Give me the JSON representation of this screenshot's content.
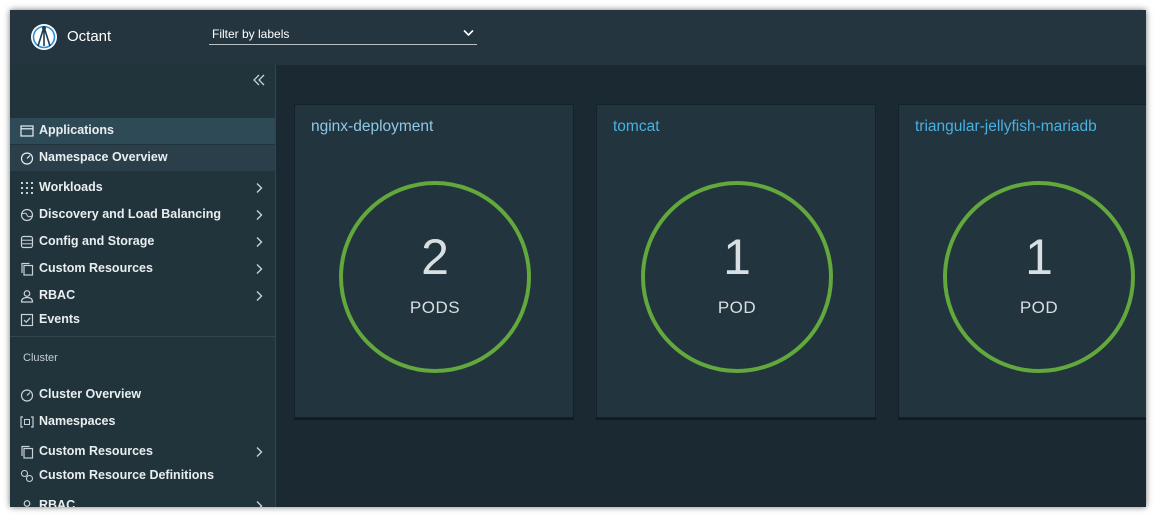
{
  "header": {
    "app_name": "Octant",
    "filter_placeholder": "Filter by labels"
  },
  "sidebar": {
    "items": [
      {
        "label": "Applications",
        "icon": "application-icon",
        "has_children": false,
        "state": "active"
      },
      {
        "label": "Namespace Overview",
        "icon": "dashboard-icon",
        "has_children": false,
        "state": "selected"
      },
      {
        "label": "Workloads",
        "icon": "grid-icon",
        "has_children": true
      },
      {
        "label": "Discovery and Load Balancing",
        "icon": "network-globe-icon",
        "has_children": true
      },
      {
        "label": "Config and Storage",
        "icon": "storage-icon",
        "has_children": true
      },
      {
        "label": "Custom Resources",
        "icon": "copy-icon",
        "has_children": true
      },
      {
        "label": "RBAC",
        "icon": "user-icon",
        "has_children": true
      },
      {
        "label": "Events",
        "icon": "checkbox-icon",
        "has_children": false
      }
    ],
    "cluster_section": {
      "label": "Cluster",
      "items": [
        {
          "label": "Cluster Overview",
          "icon": "dashboard-icon",
          "has_children": false
        },
        {
          "label": "Namespaces",
          "icon": "namespace-icon",
          "has_children": false
        },
        {
          "label": "Custom Resources",
          "icon": "copy-icon",
          "has_children": true
        },
        {
          "label": "Custom Resource Definitions",
          "icon": "crd-icon",
          "has_children": false
        },
        {
          "label": "RBAC",
          "icon": "user-icon",
          "has_children": true
        }
      ]
    }
  },
  "apps": [
    {
      "name": "nginx-deployment",
      "count": "2",
      "unit": "PODS"
    },
    {
      "name": "tomcat",
      "count": "1",
      "unit": "POD"
    },
    {
      "name": "triangular-jellyfish-mariadb",
      "count": "1",
      "unit": "POD"
    }
  ],
  "colors": {
    "header_bg": "#25353f",
    "sidebar_bg": "#21333b",
    "main_bg": "#1b2a32",
    "card_bg": "#22343d",
    "ring_green": "#62a83d",
    "link_blue": "#49b0e0",
    "active_item_bg": "#2f4a57"
  }
}
